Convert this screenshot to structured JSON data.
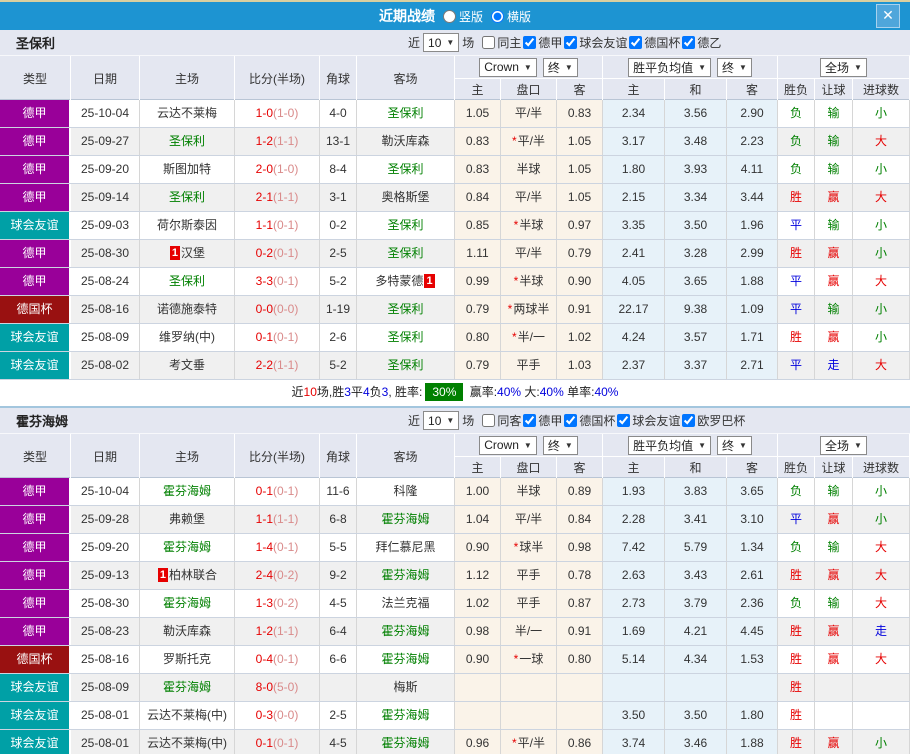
{
  "titlebar": {
    "title": "近期战绩",
    "radios": [
      {
        "label": "竖版",
        "selected": false
      },
      {
        "label": "横版",
        "selected": true
      }
    ],
    "close_icon": "✕"
  },
  "icons": {
    "dropdown_arrow": "▼"
  },
  "table_header": {
    "main_cols": [
      "类型",
      "日期",
      "主场",
      "比分(半场)",
      "角球",
      "客场"
    ],
    "sub_cols": [
      "主",
      "盘口",
      "客",
      "主",
      "和",
      "客",
      "胜负",
      "让球",
      "进球数"
    ],
    "dropdowns": {
      "bookmaker": "Crown",
      "final1": "终",
      "europe": "胜平负均值",
      "final2": "终",
      "scope": "全场"
    }
  },
  "league_colors": {
    "德甲": "#990099",
    "球会友谊": "#00a0a6",
    "德国杯": "#991111",
    "德乙": "#990099",
    "欧罗巴杯": "#991111"
  },
  "sections": [
    {
      "team": "圣保利",
      "filter": {
        "near_label": "近",
        "count": "10",
        "games_label": "场",
        "same_label": "同主",
        "same_checked": false,
        "leagues": [
          {
            "label": "德甲",
            "checked": true
          },
          {
            "label": "球会友谊",
            "checked": true
          },
          {
            "label": "德国杯",
            "checked": true
          },
          {
            "label": "德乙",
            "checked": true
          }
        ]
      },
      "rows": [
        {
          "lg": "德甲",
          "date": "25-10-04",
          "home": "云达不莱梅",
          "home_green": false,
          "home_badge": "",
          "ft": "1-0",
          "ht": "(1-0)",
          "corner": "4-0",
          "away": "圣保利",
          "away_green": true,
          "away_badge": "",
          "o1": "1.05",
          "hc_star": false,
          "hc": "平/半",
          "o2": "0.83",
          "e1": "2.34",
          "e2": "3.56",
          "e3": "2.90",
          "res": [
            [
              "负",
              "green"
            ],
            [
              "输",
              "green"
            ],
            [
              "小",
              "green"
            ]
          ]
        },
        {
          "lg": "德甲",
          "date": "25-09-27",
          "home": "圣保利",
          "home_green": true,
          "home_badge": "",
          "ft": "1-2",
          "ht": "(1-1)",
          "corner": "13-1",
          "away": "勒沃库森",
          "away_green": false,
          "away_badge": "",
          "o1": "0.83",
          "hc_star": true,
          "hc": "平/半",
          "o2": "1.05",
          "e1": "3.17",
          "e2": "3.48",
          "e3": "2.23",
          "res": [
            [
              "负",
              "green"
            ],
            [
              "输",
              "green"
            ],
            [
              "大",
              "red"
            ]
          ]
        },
        {
          "lg": "德甲",
          "date": "25-09-20",
          "home": "斯图加特",
          "home_green": false,
          "home_badge": "",
          "ft": "2-0",
          "ht": "(1-0)",
          "corner": "8-4",
          "away": "圣保利",
          "away_green": true,
          "away_badge": "",
          "o1": "0.83",
          "hc_star": false,
          "hc": "半球",
          "o2": "1.05",
          "e1": "1.80",
          "e2": "3.93",
          "e3": "4.11",
          "res": [
            [
              "负",
              "green"
            ],
            [
              "输",
              "green"
            ],
            [
              "小",
              "green"
            ]
          ]
        },
        {
          "lg": "德甲",
          "date": "25-09-14",
          "home": "圣保利",
          "home_green": true,
          "home_badge": "",
          "ft": "2-1",
          "ht": "(1-1)",
          "corner": "3-1",
          "away": "奥格斯堡",
          "away_green": false,
          "away_badge": "",
          "o1": "0.84",
          "hc_star": false,
          "hc": "平/半",
          "o2": "1.05",
          "e1": "2.15",
          "e2": "3.34",
          "e3": "3.44",
          "res": [
            [
              "胜",
              "red"
            ],
            [
              "赢",
              "red"
            ],
            [
              "大",
              "red"
            ]
          ]
        },
        {
          "lg": "球会友谊",
          "date": "25-09-03",
          "home": "荷尔斯泰因",
          "home_green": false,
          "home_badge": "",
          "ft": "1-1",
          "ht": "(0-1)",
          "corner": "0-2",
          "away": "圣保利",
          "away_green": true,
          "away_badge": "",
          "o1": "0.85",
          "hc_star": true,
          "hc": "半球",
          "o2": "0.97",
          "e1": "3.35",
          "e2": "3.50",
          "e3": "1.96",
          "res": [
            [
              "平",
              "blue"
            ],
            [
              "输",
              "green"
            ],
            [
              "小",
              "green"
            ]
          ]
        },
        {
          "lg": "德甲",
          "date": "25-08-30",
          "home": "汉堡",
          "home_green": false,
          "home_badge": "1",
          "ft": "0-2",
          "ht": "(0-1)",
          "corner": "2-5",
          "away": "圣保利",
          "away_green": true,
          "away_badge": "",
          "o1": "1.11",
          "hc_star": false,
          "hc": "平/半",
          "o2": "0.79",
          "e1": "2.41",
          "e2": "3.28",
          "e3": "2.99",
          "res": [
            [
              "胜",
              "red"
            ],
            [
              "赢",
              "red"
            ],
            [
              "小",
              "green"
            ]
          ]
        },
        {
          "lg": "德甲",
          "date": "25-08-24",
          "home": "圣保利",
          "home_green": true,
          "home_badge": "",
          "ft": "3-3",
          "ht": "(0-1)",
          "corner": "5-2",
          "away": "多特蒙德",
          "away_green": false,
          "away_badge": "1",
          "o1": "0.99",
          "hc_star": true,
          "hc": "半球",
          "o2": "0.90",
          "e1": "4.05",
          "e2": "3.65",
          "e3": "1.88",
          "res": [
            [
              "平",
              "blue"
            ],
            [
              "赢",
              "red"
            ],
            [
              "大",
              "red"
            ]
          ]
        },
        {
          "lg": "德国杯",
          "date": "25-08-16",
          "home": "诺德施泰特",
          "home_green": false,
          "home_badge": "",
          "ft": "0-0",
          "ht": "(0-0)",
          "corner": "1-19",
          "away": "圣保利",
          "away_green": true,
          "away_badge": "",
          "o1": "0.79",
          "hc_star": true,
          "hc": "两球半",
          "o2": "0.91",
          "e1": "22.17",
          "e2": "9.38",
          "e3": "1.09",
          "res": [
            [
              "平",
              "blue"
            ],
            [
              "输",
              "green"
            ],
            [
              "小",
              "green"
            ]
          ]
        },
        {
          "lg": "球会友谊",
          "date": "25-08-09",
          "home": "维罗纳(中)",
          "home_green": false,
          "home_badge": "",
          "ft": "0-1",
          "ht": "(0-1)",
          "corner": "2-6",
          "away": "圣保利",
          "away_green": true,
          "away_badge": "",
          "o1": "0.80",
          "hc_star": true,
          "hc": "半/一",
          "o2": "1.02",
          "e1": "4.24",
          "e2": "3.57",
          "e3": "1.71",
          "res": [
            [
              "胜",
              "red"
            ],
            [
              "赢",
              "red"
            ],
            [
              "小",
              "green"
            ]
          ]
        },
        {
          "lg": "球会友谊",
          "date": "25-08-02",
          "home": "考文垂",
          "home_green": false,
          "home_badge": "",
          "ft": "2-2",
          "ht": "(1-1)",
          "corner": "5-2",
          "away": "圣保利",
          "away_green": true,
          "away_badge": "",
          "o1": "0.79",
          "hc_star": false,
          "hc": "平手",
          "o2": "1.03",
          "e1": "2.37",
          "e2": "3.37",
          "e3": "2.71",
          "res": [
            [
              "平",
              "blue"
            ],
            [
              "走",
              "blue"
            ],
            [
              "大",
              "red"
            ]
          ]
        }
      ],
      "summary": [
        {
          "t": "近"
        },
        {
          "t": "10",
          "c": "red"
        },
        {
          "t": "场,胜"
        },
        {
          "t": "3",
          "c": "blue"
        },
        {
          "t": "平"
        },
        {
          "t": "4",
          "c": "blue"
        },
        {
          "t": "负"
        },
        {
          "t": "3",
          "c": "blue"
        },
        {
          "t": ", 胜率:"
        },
        {
          "t": "30%",
          "badge": true
        },
        {
          "t": " 赢率:"
        },
        {
          "t": "40%",
          "c": "blue"
        },
        {
          "t": " 大:"
        },
        {
          "t": "40%",
          "c": "blue"
        },
        {
          "t": " 单率:"
        },
        {
          "t": "40%",
          "c": "blue"
        }
      ]
    },
    {
      "team": "霍芬海姆",
      "filter": {
        "near_label": "近",
        "count": "10",
        "games_label": "场",
        "same_label": "同客",
        "same_checked": false,
        "leagues": [
          {
            "label": "德甲",
            "checked": true
          },
          {
            "label": "德国杯",
            "checked": true
          },
          {
            "label": "球会友谊",
            "checked": true
          },
          {
            "label": "欧罗巴杯",
            "checked": true
          }
        ]
      },
      "rows": [
        {
          "lg": "德甲",
          "date": "25-10-04",
          "home": "霍芬海姆",
          "home_green": true,
          "home_badge": "",
          "ft": "0-1",
          "ht": "(0-1)",
          "corner": "11-6",
          "away": "科隆",
          "away_green": false,
          "away_badge": "",
          "o1": "1.00",
          "hc_star": false,
          "hc": "半球",
          "o2": "0.89",
          "e1": "1.93",
          "e2": "3.83",
          "e3": "3.65",
          "res": [
            [
              "负",
              "green"
            ],
            [
              "输",
              "green"
            ],
            [
              "小",
              "green"
            ]
          ]
        },
        {
          "lg": "德甲",
          "date": "25-09-28",
          "home": "弗赖堡",
          "home_green": false,
          "home_badge": "",
          "ft": "1-1",
          "ht": "(1-1)",
          "corner": "6-8",
          "away": "霍芬海姆",
          "away_green": true,
          "away_badge": "",
          "o1": "1.04",
          "hc_star": false,
          "hc": "平/半",
          "o2": "0.84",
          "e1": "2.28",
          "e2": "3.41",
          "e3": "3.10",
          "res": [
            [
              "平",
              "blue"
            ],
            [
              "赢",
              "red"
            ],
            [
              "小",
              "green"
            ]
          ]
        },
        {
          "lg": "德甲",
          "date": "25-09-20",
          "home": "霍芬海姆",
          "home_green": true,
          "home_badge": "",
          "ft": "1-4",
          "ht": "(0-1)",
          "corner": "5-5",
          "away": "拜仁慕尼黑",
          "away_green": false,
          "away_badge": "",
          "o1": "0.90",
          "hc_star": true,
          "hc": "球半",
          "o2": "0.98",
          "e1": "7.42",
          "e2": "5.79",
          "e3": "1.34",
          "res": [
            [
              "负",
              "green"
            ],
            [
              "输",
              "green"
            ],
            [
              "大",
              "red"
            ]
          ]
        },
        {
          "lg": "德甲",
          "date": "25-09-13",
          "home": "柏林联合",
          "home_green": false,
          "home_badge": "1",
          "ft": "2-4",
          "ht": "(0-2)",
          "corner": "9-2",
          "away": "霍芬海姆",
          "away_green": true,
          "away_badge": "",
          "o1": "1.12",
          "hc_star": false,
          "hc": "平手",
          "o2": "0.78",
          "e1": "2.63",
          "e2": "3.43",
          "e3": "2.61",
          "res": [
            [
              "胜",
              "red"
            ],
            [
              "赢",
              "red"
            ],
            [
              "大",
              "red"
            ]
          ]
        },
        {
          "lg": "德甲",
          "date": "25-08-30",
          "home": "霍芬海姆",
          "home_green": true,
          "home_badge": "",
          "ft": "1-3",
          "ht": "(0-2)",
          "corner": "4-5",
          "away": "法兰克福",
          "away_green": false,
          "away_badge": "",
          "o1": "1.02",
          "hc_star": false,
          "hc": "平手",
          "o2": "0.87",
          "e1": "2.73",
          "e2": "3.79",
          "e3": "2.36",
          "res": [
            [
              "负",
              "green"
            ],
            [
              "输",
              "green"
            ],
            [
              "大",
              "red"
            ]
          ]
        },
        {
          "lg": "德甲",
          "date": "25-08-23",
          "home": "勒沃库森",
          "home_green": false,
          "home_badge": "",
          "ft": "1-2",
          "ht": "(1-1)",
          "corner": "6-4",
          "away": "霍芬海姆",
          "away_green": true,
          "away_badge": "",
          "o1": "0.98",
          "hc_star": false,
          "hc": "半/一",
          "o2": "0.91",
          "e1": "1.69",
          "e2": "4.21",
          "e3": "4.45",
          "res": [
            [
              "胜",
              "red"
            ],
            [
              "赢",
              "red"
            ],
            [
              "走",
              "blue"
            ]
          ]
        },
        {
          "lg": "德国杯",
          "date": "25-08-16",
          "home": "罗斯托克",
          "home_green": false,
          "home_badge": "",
          "ft": "0-4",
          "ht": "(0-1)",
          "corner": "6-6",
          "away": "霍芬海姆",
          "away_green": true,
          "away_badge": "",
          "o1": "0.90",
          "hc_star": true,
          "hc": "一球",
          "o2": "0.80",
          "e1": "5.14",
          "e2": "4.34",
          "e3": "1.53",
          "res": [
            [
              "胜",
              "red"
            ],
            [
              "赢",
              "red"
            ],
            [
              "大",
              "red"
            ]
          ]
        },
        {
          "lg": "球会友谊",
          "date": "25-08-09",
          "home": "霍芬海姆",
          "home_green": true,
          "home_badge": "",
          "ft": "8-0",
          "ht": "(5-0)",
          "corner": "",
          "away": "梅斯",
          "away_green": false,
          "away_badge": "",
          "o1": "",
          "hc_star": false,
          "hc": "",
          "o2": "",
          "e1": "",
          "e2": "",
          "e3": "",
          "res": [
            [
              "胜",
              "red"
            ],
            [
              "",
              ""
            ],
            [
              "",
              ""
            ]
          ]
        },
        {
          "lg": "球会友谊",
          "date": "25-08-01",
          "home": "云达不莱梅(中)",
          "home_green": false,
          "home_badge": "",
          "ft": "0-3",
          "ht": "(0-0)",
          "corner": "2-5",
          "away": "霍芬海姆",
          "away_green": true,
          "away_badge": "",
          "o1": "",
          "hc_star": false,
          "hc": "",
          "o2": "",
          "e1": "3.50",
          "e2": "3.50",
          "e3": "1.80",
          "res": [
            [
              "胜",
              "red"
            ],
            [
              "",
              ""
            ],
            [
              "",
              ""
            ]
          ]
        },
        {
          "lg": "球会友谊",
          "date": "25-08-01",
          "home": "云达不莱梅(中)",
          "home_green": false,
          "home_badge": "",
          "ft": "0-1",
          "ht": "(0-1)",
          "corner": "4-5",
          "away": "霍芬海姆",
          "away_green": true,
          "away_badge": "",
          "o1": "0.96",
          "hc_star": true,
          "hc": "平/半",
          "o2": "0.86",
          "e1": "3.74",
          "e2": "3.46",
          "e3": "1.88",
          "res": [
            [
              "胜",
              "red"
            ],
            [
              "赢",
              "red"
            ],
            [
              "小",
              "green"
            ]
          ]
        }
      ],
      "summary": null
    }
  ]
}
